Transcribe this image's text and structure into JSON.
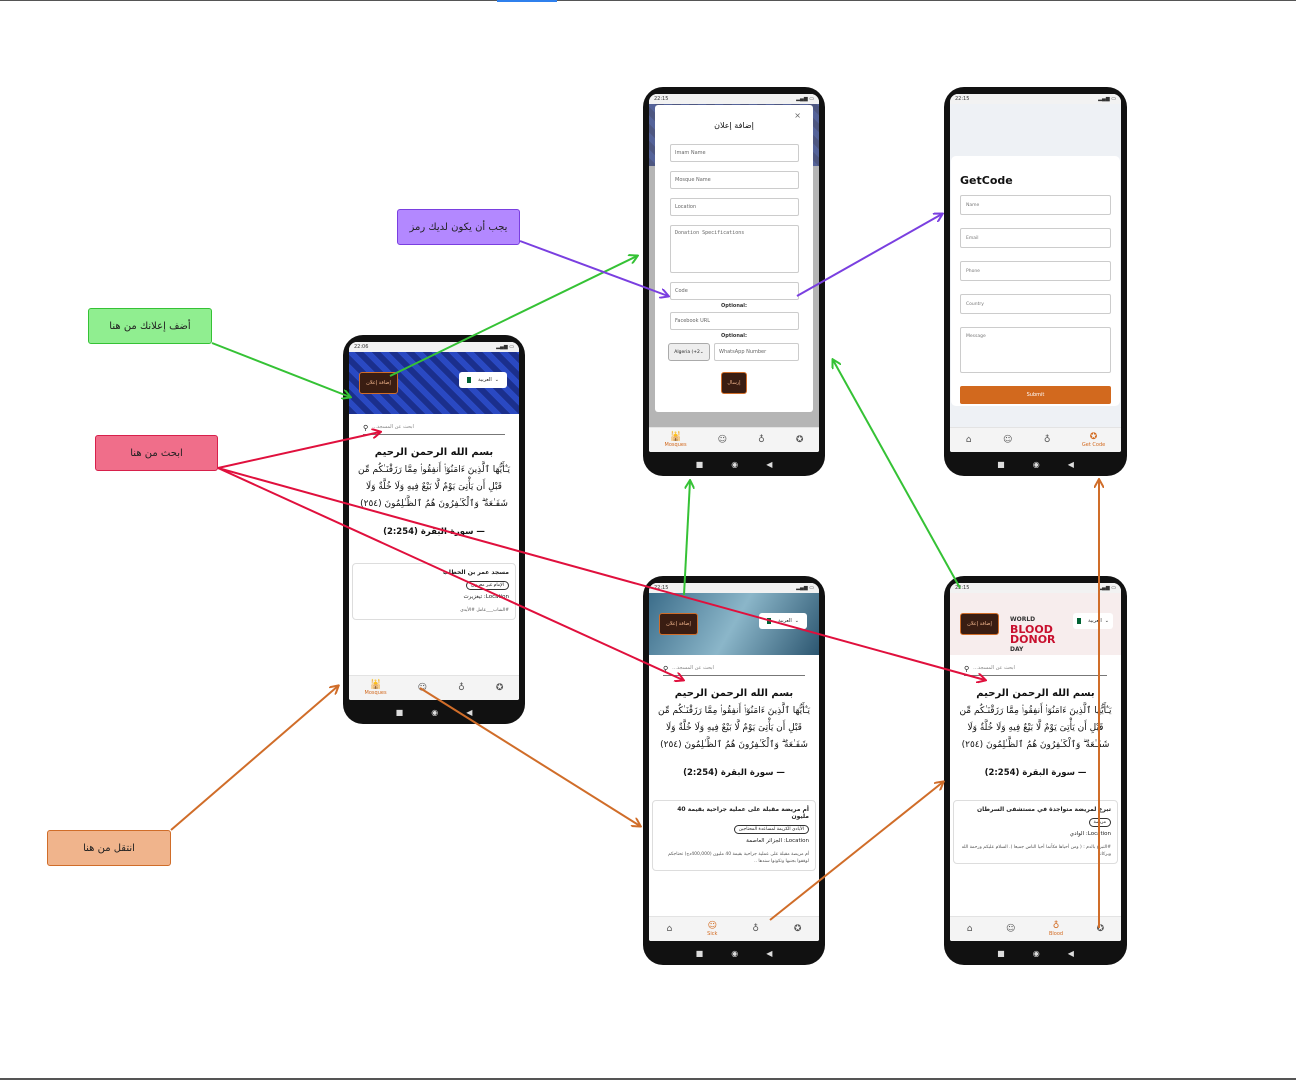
{
  "notes": {
    "green": "أضف إعلانك من هنا",
    "purple": "يجب أن يكون لديك رمز",
    "red": "ابحث من هنا",
    "orange": "انتقل من هنا"
  },
  "colors": {
    "green": "#35c235",
    "purple": "#7a3fe0",
    "red": "#e0103d",
    "orange": "#d06d29"
  },
  "common": {
    "add_ad": "إضافة إعلان",
    "lang": "العربية",
    "search_placeholder": "...ابحث عن المسجد",
    "basmala": "بسم الله الرحمن الرحيم",
    "verse": "يَـٰٓأَيُّهَا ٱلَّذِينَ ءَامَنُوٓا۟ أَنفِقُوا۟ مِمَّا رَزَقْنَـٰكُم مِّن قَبْلِ أَن يَأْتِىَ يَوْمٌ لَّا بَيْعٌ فِيهِ وَلَا خُلَّةٌ وَلَا شَفَـٰعَةٌ ۗ وَٱلْكَـٰفِرُونَ هُمُ ٱلظَّـٰلِمُونَ (٢٥٤)",
    "surah": "سورة البقرة (2:254) —"
  },
  "phone_main": {
    "time": "22:06",
    "card_title": "مسجد عمر بن الخطاب",
    "card_chip": "الإمام غير معروف",
    "card_location": "Location: تيغزيرت",
    "card_desc": "#الشاب___عامل #الأيدي",
    "nav": [
      "Mosques",
      "",
      "",
      ""
    ]
  },
  "phone_modal": {
    "time": "22:15",
    "title": "إضافة إعلان",
    "close": "×",
    "imam": "Imam Name",
    "mosque": "Mosque Name",
    "location": "Location",
    "donation": "Donation Specifications",
    "code": "Code",
    "optional1": "Optional:",
    "facebook": "Facebook URL",
    "optional2": "Optional:",
    "country_code": "Algeria (+2",
    "whatsapp": "WhatsApp Number",
    "send": "إرسال",
    "nav": [
      "Mosques",
      "",
      "",
      ""
    ]
  },
  "phone_getcode": {
    "time": "22:15",
    "title": "GetCode",
    "name": "Name",
    "email": "Email",
    "phone": "Phone",
    "country": "Country",
    "message": "Message",
    "submit": "Submit",
    "nav": [
      "",
      "",
      "",
      "Get Code"
    ]
  },
  "phone_sick": {
    "time": "22:15",
    "card_title": "أم مريضة مقبلة على عملية جراحية بقيمة 40 مليون",
    "card_chip": "الأيادي الكريمة لمساعدة المحتاجين",
    "card_location": "Location: الجزائر العاصمة",
    "card_desc": "أم مريضة مقبلة على عملية جراحية بقيمة 40 مليون (400,000دج) تحتاجكم لوقفوا بجنبها وتكونوا سندها ..",
    "nav": [
      "",
      "Sick",
      "",
      ""
    ]
  },
  "phone_blood": {
    "time": "22:15",
    "banner_small": "WORLD",
    "banner_big1": "BLOOD",
    "banner_big2": "DONOR",
    "banner_small2": "DAY",
    "card_title": "تبرع لمريضة متواجدة في مستشفى السرطان",
    "card_chip": "مريضة",
    "card_location": "Location: الوادي",
    "card_desc": "#التبرع بالدم : ( ومن أحياها فكأنما أحيا الناس جميعا ). السلام عليكم ورحمة الله وبركاته",
    "nav": [
      "",
      "",
      "Blood",
      ""
    ]
  }
}
